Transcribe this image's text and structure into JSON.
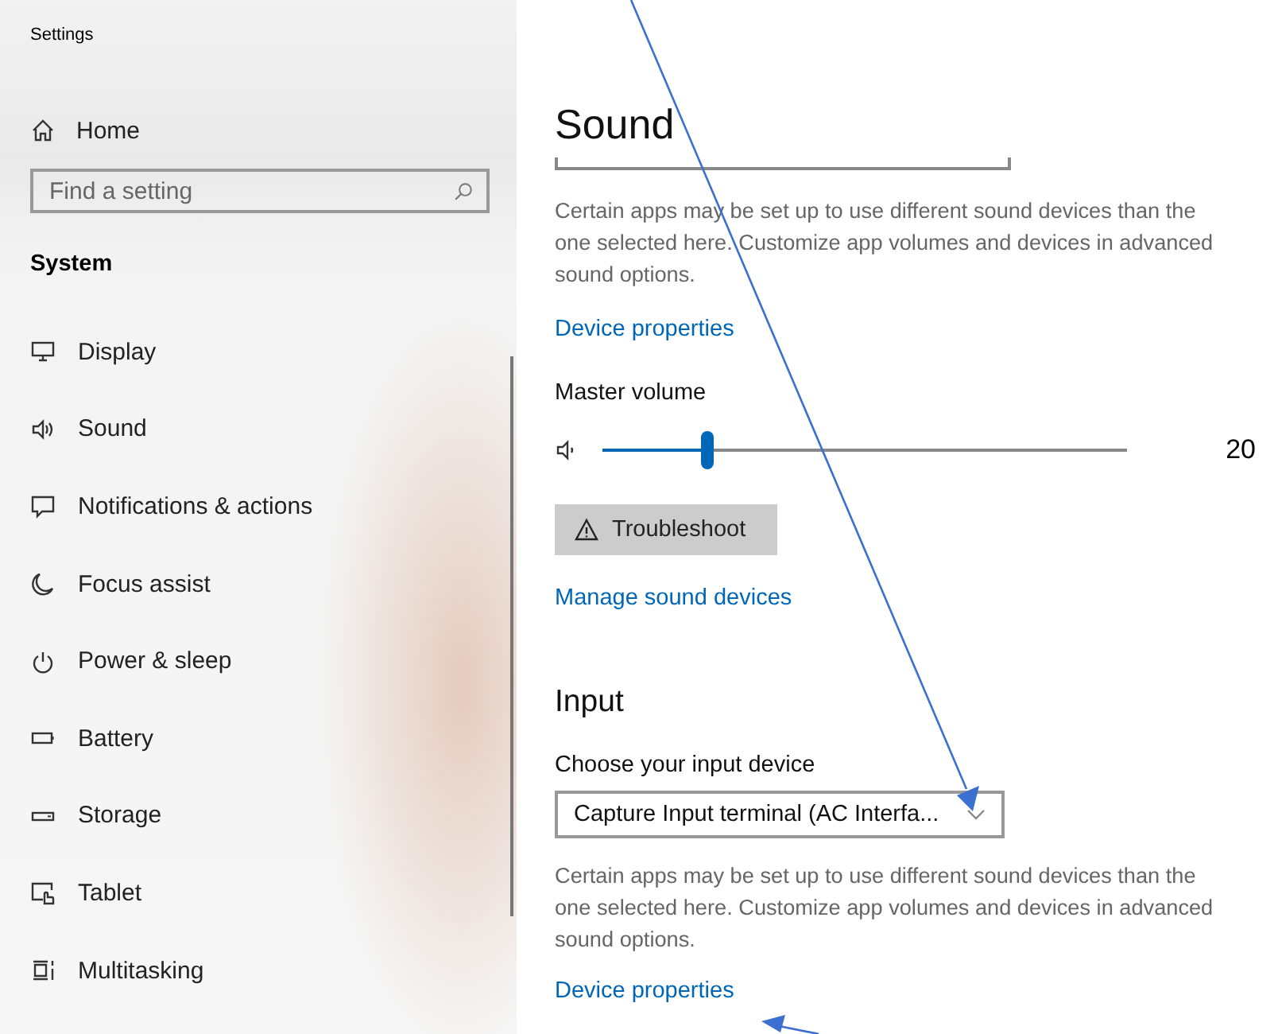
{
  "window": {
    "title": "Settings"
  },
  "sidebar": {
    "home": "Home",
    "search": {
      "placeholder": "Find a setting"
    },
    "section": "System",
    "items": [
      {
        "label": "Display"
      },
      {
        "label": "Sound"
      },
      {
        "label": "Notifications & actions"
      },
      {
        "label": "Focus assist"
      },
      {
        "label": "Power & sleep"
      },
      {
        "label": "Battery"
      },
      {
        "label": "Storage"
      },
      {
        "label": "Tablet"
      },
      {
        "label": "Multitasking"
      }
    ]
  },
  "content": {
    "title": "Sound",
    "output_note": "Certain apps may be set up to use different sound devices than the one selected here. Customize app volumes and devices in advanced sound options.",
    "output_link": "Device properties",
    "volume": {
      "label": "Master volume",
      "level": 0.2,
      "reading": "20"
    },
    "troubleshoot": "Troubleshoot",
    "manage_link": "Manage sound devices",
    "input": {
      "heading": "Input",
      "label": "Choose your input device",
      "value": "Capture Input terminal (AC Interfa...",
      "note": "Certain apps may be set up to use different sound devices than the one selected here. Customize app volumes and devices in advanced sound options.",
      "link": "Device properties"
    }
  }
}
